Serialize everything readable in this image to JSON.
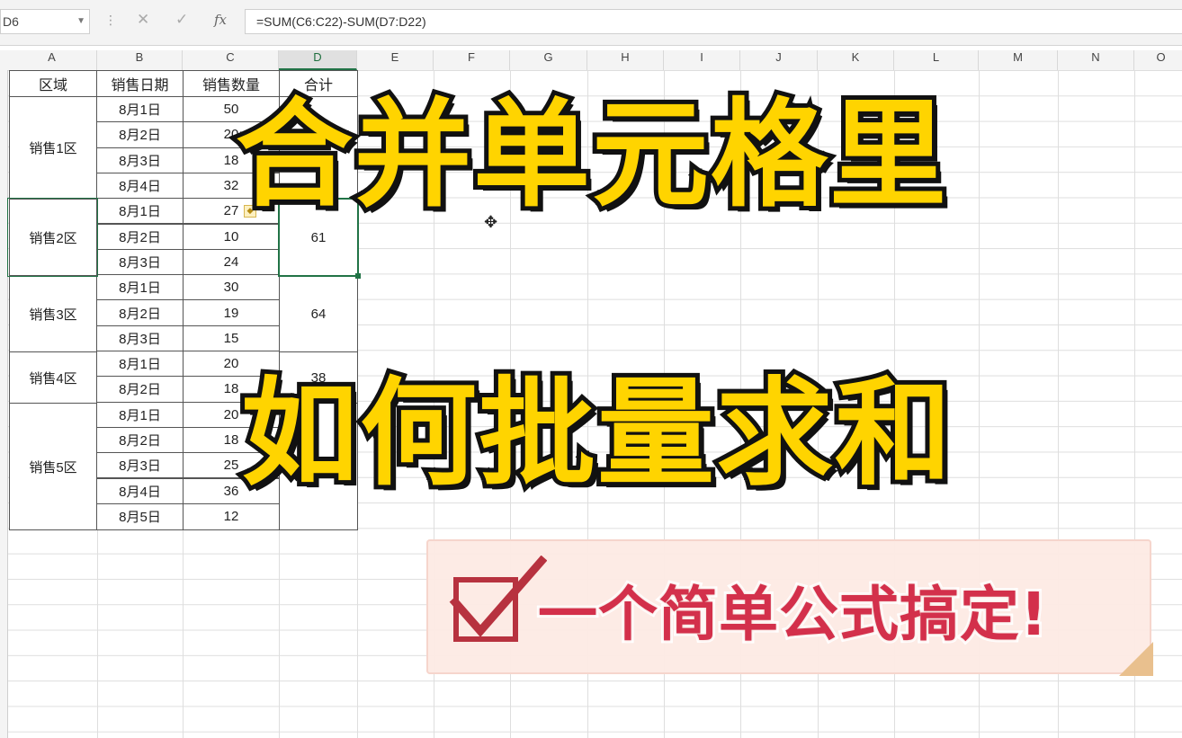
{
  "formula_bar": {
    "name_box": "D6",
    "formula": "=SUM(C6:C22)-SUM(D7:D22)",
    "cancel_icon": "✕",
    "enter_icon": "✓",
    "fx_label": "fx"
  },
  "columns": [
    "A",
    "B",
    "C",
    "D",
    "E",
    "F",
    "G",
    "H",
    "I",
    "J",
    "K",
    "L",
    "M",
    "N",
    "O"
  ],
  "table": {
    "headers": [
      "区域",
      "销售日期",
      "销售数量",
      "合计"
    ],
    "regions": [
      "销售1区",
      "销售2区",
      "销售3区",
      "销售4区",
      "销售5区"
    ],
    "dates": [
      "8月1日",
      "8月2日",
      "8月3日",
      "8月4日",
      "8月1日",
      "8月2日",
      "8月3日",
      "8月1日",
      "8月2日",
      "8月3日",
      "8月1日",
      "8月2日",
      "8月1日",
      "8月2日",
      "8月3日",
      "8月4日",
      "8月5日"
    ],
    "quantities": [
      "50",
      "20",
      "18",
      "32",
      "27",
      "10",
      "24",
      "30",
      "19",
      "15",
      "20",
      "18",
      "20",
      "18",
      "25",
      "36",
      "12"
    ],
    "totals": [
      "61",
      "64",
      "38"
    ]
  },
  "overlay": {
    "title_line1": "合并单元格里",
    "title_line2": "如何批量求和",
    "slogan": "一个简单公式搞定!"
  }
}
